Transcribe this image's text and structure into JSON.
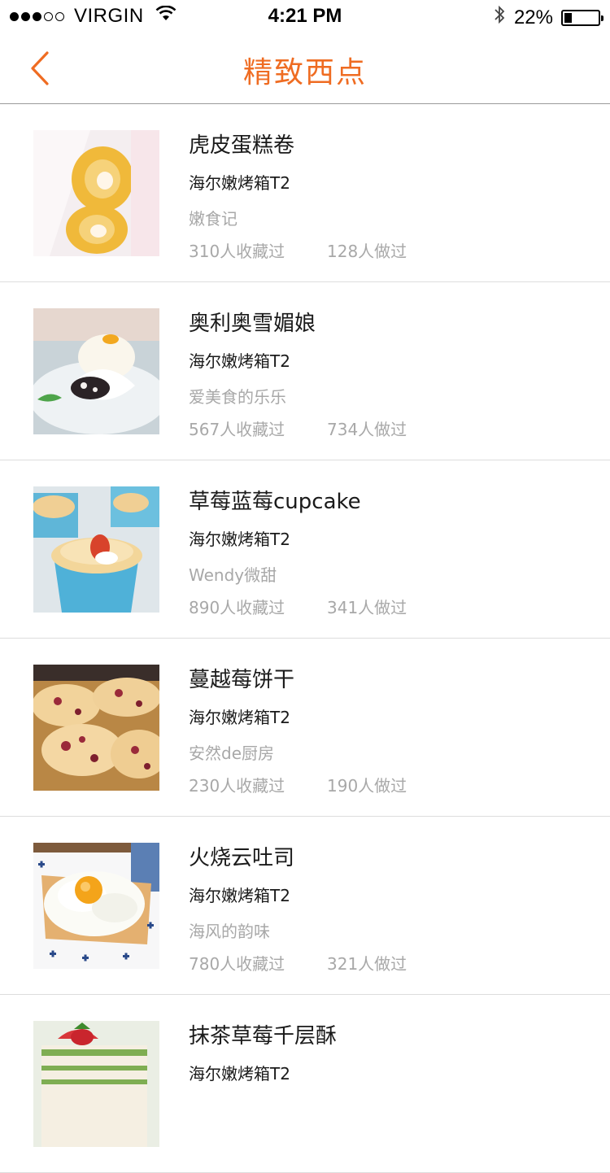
{
  "status_bar": {
    "carrier": "VIRGIN",
    "time": "4:21 PM",
    "battery": "22%",
    "battery_level": 0.22
  },
  "nav": {
    "title": "精致西点"
  },
  "recipes": [
    {
      "name": "虎皮蛋糕卷",
      "device": "海尔嫩烤箱T2",
      "author": "嫩食记",
      "favorites": "310人收藏过",
      "made": "128人做过"
    },
    {
      "name": "奥利奥雪媚娘",
      "device": "海尔嫩烤箱T2",
      "author": "爱美食的乐乐",
      "favorites": "567人收藏过",
      "made": "734人做过"
    },
    {
      "name": "草莓蓝莓cupcake",
      "device": "海尔嫩烤箱T2",
      "author": "Wendy微甜",
      "favorites": "890人收藏过",
      "made": "341人做过"
    },
    {
      "name": "蔓越莓饼干",
      "device": "海尔嫩烤箱T2",
      "author": "安然de厨房",
      "favorites": "230人收藏过",
      "made": "190人做过"
    },
    {
      "name": "火烧云吐司",
      "device": "海尔嫩烤箱T2",
      "author": "海风的韵味",
      "favorites": "780人收藏过",
      "made": "321人做过"
    },
    {
      "name": "抹茶草莓千层酥",
      "device": "海尔嫩烤箱T2",
      "author": "",
      "favorites": "",
      "made": ""
    }
  ]
}
